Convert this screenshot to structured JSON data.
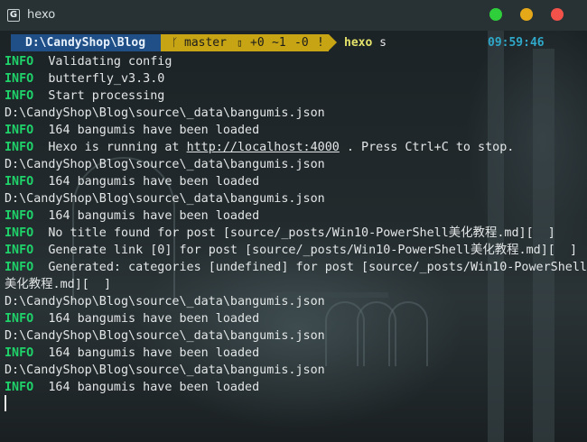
{
  "window": {
    "title": "hexo",
    "app_icon": "G",
    "controls": [
      "minimize",
      "maximize",
      "close"
    ]
  },
  "prompt": {
    "path": "D:\\CandyShop\\Blog",
    "git_branch_icon": "branch-icon",
    "branch": "master",
    "status_icon": "▯",
    "status_added": "+0",
    "status_modified": "~1",
    "status_deleted": "-0",
    "status_flag": "!",
    "command": "hexo",
    "command_arg": "s",
    "time": "09:59:46"
  },
  "colors": {
    "info_tag": "#1fd26a",
    "path_segment": "#1f4f86",
    "git_segment": "#c7a413",
    "command": "#e5e36a",
    "clock": "#2fa8c9"
  },
  "output": [
    {
      "tag": "INFO",
      "text": "  Validating config"
    },
    {
      "tag": "INFO",
      "text": "  butterfly_v3.3.0"
    },
    {
      "tag": "INFO",
      "text": "  Start processing"
    },
    {
      "tag": "",
      "text": "D:\\CandyShop\\Blog\\source\\_data\\bangumis.json"
    },
    {
      "tag": "INFO",
      "text": "  164 bangumis have been loaded"
    },
    {
      "tag": "INFO",
      "text": "  Hexo is running at ",
      "link": "http://localhost:4000",
      "after": " . Press Ctrl+C to stop."
    },
    {
      "tag": "",
      "text": "D:\\CandyShop\\Blog\\source\\_data\\bangumis.json"
    },
    {
      "tag": "INFO",
      "text": "  164 bangumis have been loaded"
    },
    {
      "tag": "",
      "text": "D:\\CandyShop\\Blog\\source\\_data\\bangumis.json"
    },
    {
      "tag": "INFO",
      "text": "  164 bangumis have been loaded"
    },
    {
      "tag": "INFO",
      "text": "  No title found for post [source/_posts/Win10-PowerShell美化教程.md][  ]"
    },
    {
      "tag": "INFO",
      "text": "  Generate link [0] for post [source/_posts/Win10-PowerShell美化教程.md][  ]"
    },
    {
      "tag": "INFO",
      "text": "  Generated: categories [undefined] for post [source/_posts/Win10-PowerShell"
    },
    {
      "tag": "",
      "text": "美化教程.md][  ]"
    },
    {
      "tag": "",
      "text": "D:\\CandyShop\\Blog\\source\\_data\\bangumis.json"
    },
    {
      "tag": "INFO",
      "text": "  164 bangumis have been loaded"
    },
    {
      "tag": "",
      "text": "D:\\CandyShop\\Blog\\source\\_data\\bangumis.json"
    },
    {
      "tag": "INFO",
      "text": "  164 bangumis have been loaded"
    },
    {
      "tag": "",
      "text": "D:\\CandyShop\\Blog\\source\\_data\\bangumis.json"
    },
    {
      "tag": "INFO",
      "text": "  164 bangumis have been loaded"
    }
  ]
}
